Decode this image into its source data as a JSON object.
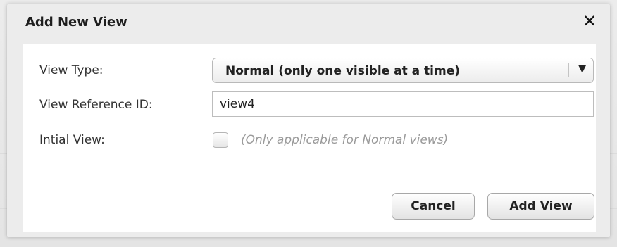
{
  "dialog": {
    "title": "Add New View",
    "close_icon": "close-icon"
  },
  "form": {
    "view_type": {
      "label": "View Type:",
      "selected": "Normal (only one visible at a time)",
      "arrow_icon": "triangle-down-icon"
    },
    "view_reference_id": {
      "label": "View Reference ID:",
      "value": "view4"
    },
    "initial_view": {
      "label": "Intial View:",
      "checked": false,
      "hint": "(Only applicable for Normal views)"
    }
  },
  "buttons": {
    "cancel": "Cancel",
    "add_view": "Add View"
  },
  "icons": {
    "close": "✕",
    "dropdown": "▼"
  }
}
